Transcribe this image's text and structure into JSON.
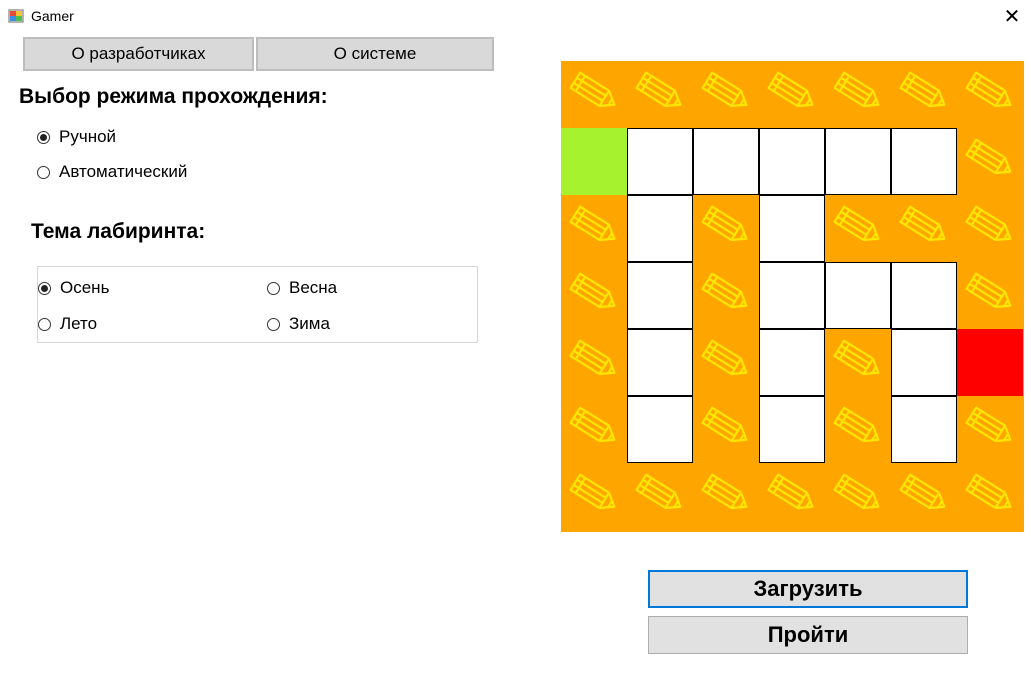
{
  "window": {
    "title": "Gamer",
    "icon": "app-window-icon",
    "close_icon": "close-icon"
  },
  "toolbar": {
    "developers_label": "О разработчиках",
    "system_label": "О системе"
  },
  "mode": {
    "title": "Выбор режима прохождения:",
    "options": [
      {
        "label": "Ручной",
        "selected": true
      },
      {
        "label": "Автоматический",
        "selected": false
      }
    ]
  },
  "theme": {
    "title": "Тема лабиринта:",
    "options": [
      {
        "label": "Осень",
        "selected": true
      },
      {
        "label": "Весна",
        "selected": false
      },
      {
        "label": "Лето",
        "selected": false
      },
      {
        "label": "Зима",
        "selected": false
      }
    ]
  },
  "maze": {
    "grid": [
      "WWWWWWW",
      "SPPPPPW",
      "WPWPWWW",
      "WPWPPPW",
      "WPWPWPE",
      "WPWPWPW",
      "WWWWWWW"
    ],
    "legend": {
      "W": "wall",
      "P": "path",
      "S": "start",
      "E": "exit"
    },
    "wall_icon": "pencil-icon",
    "colors": {
      "wall": "#ffa500",
      "path": "#ffffff",
      "start": "#a6f22e",
      "exit": "#ff0000",
      "pencil": "#ffe600"
    }
  },
  "actions": {
    "load_label": "Загрузить",
    "go_label": "Пройти"
  }
}
